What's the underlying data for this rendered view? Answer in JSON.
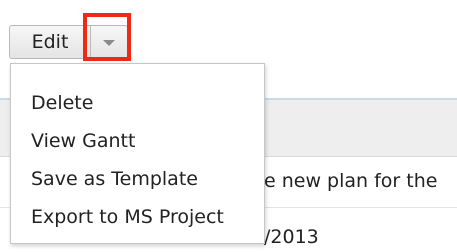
{
  "toolbar": {
    "edit_label": "Edit",
    "dropdown_toggle_icon": "chevron-down-icon",
    "highlight_color": "#ee2a12"
  },
  "dropdown_menu": {
    "items": [
      {
        "label": "Delete"
      },
      {
        "label": "View Gantt"
      },
      {
        "label": "Save as Template"
      },
      {
        "label": "Export to MS Project"
      }
    ]
  },
  "background_content": {
    "row_1_text": "e new plan for the",
    "row_2_text": "/2013"
  }
}
